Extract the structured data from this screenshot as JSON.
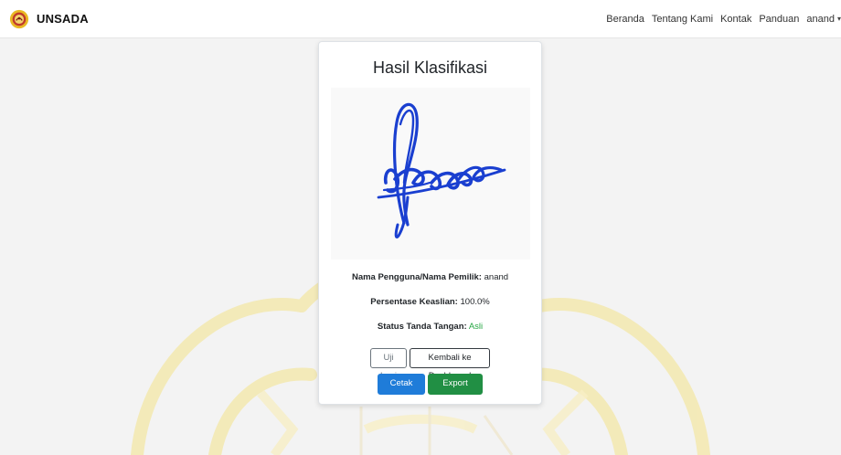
{
  "navbar": {
    "brand": "UNSADA",
    "links": [
      "Beranda",
      "Tentang Kami",
      "Kontak",
      "Panduan"
    ],
    "user": "anand"
  },
  "card": {
    "title": "Hasil Klasifikasi",
    "owner_label": "Nama Pengguna/Nama Pemilik:",
    "owner_value": "anand",
    "pct_label": "Persentase Keaslian:",
    "pct_value": "100.0%",
    "status_label": "Status Tanda Tangan:",
    "status_value": "Asli",
    "buttons": {
      "retry": "Uji Lagi",
      "back": "Kembali ke Dashboard",
      "pdf": "Cetak PDF",
      "excel": "Export Excel"
    }
  },
  "colors": {
    "signature_ink": "#1a3fd0",
    "status_ok": "#28a745",
    "primary": "#1f7cd9",
    "success": "#218f44",
    "watermark": "#f7e89a"
  },
  "icons": {
    "brand_logo": "university-logo-icon",
    "user_menu": "chevron-down-icon"
  }
}
